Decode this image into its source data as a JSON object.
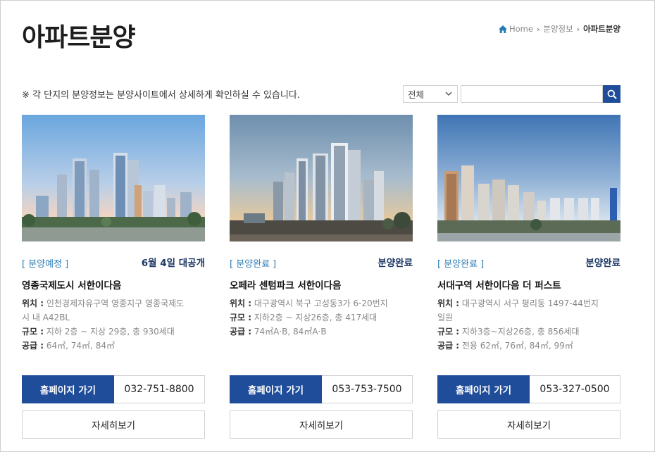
{
  "page": {
    "title": "아파트분양",
    "breadcrumb": [
      "Home",
      "분양정보",
      "아파트분양"
    ]
  },
  "notice": "※ 각 단지의 분양정보는 분양사이트에서 상세하게 확인하실 수 있습니다.",
  "filter": {
    "selected": "전체",
    "search_value": ""
  },
  "colors": {
    "primary": "#1f4d99",
    "status_tag": "#2a7bb5",
    "status_right": "#1e3a66"
  },
  "icons": {
    "home": "home-icon",
    "search": "search-icon",
    "select": "chevron-down-icon"
  },
  "cards": [
    {
      "tag": "[ 분양예정 ]",
      "status": "6월 4일 대공개",
      "name": "영종국제도시 서한이다음",
      "location_label": "위치 :",
      "location": "인천경제자유구역 영종지구 영종국제도",
      "location_cont": "시 내 A42BL",
      "scale_label": "규모 :",
      "scale": "지하 2층 ~ 지상 29층, 총 930세대",
      "supply_label": "공급 :",
      "supply": "64㎡, 74㎡, 84㎡",
      "homepage_label": "홈페이지 가기",
      "phone": "032-751-8800",
      "detail_label": "자세히보기"
    },
    {
      "tag": "[ 분양완료 ]",
      "status": "분양완료",
      "name": "오페라 센텀파크 서한이다음",
      "location_label": "위치 :",
      "location": "대구광역시 북구 고성동3가 6-20번지",
      "location_cont": "",
      "scale_label": "규모 :",
      "scale": "지하2층 ~ 지상26층, 총 417세대",
      "supply_label": "공급 :",
      "supply": "74㎡A·B, 84㎡A·B",
      "homepage_label": "홈페이지 가기",
      "phone": "053-753-7500",
      "detail_label": "자세히보기"
    },
    {
      "tag": "[ 분양완료 ]",
      "status": "분양완료",
      "name": "서대구역 서한이다음 더 퍼스트",
      "location_label": "위치 :",
      "location": "대구광역시 서구 평리동 1497-44번지",
      "location_cont": "일원",
      "scale_label": "규모 :",
      "scale": "지하3층~지상26층, 총 856세대",
      "supply_label": "공급 :",
      "supply": "전용 62㎡, 76㎡, 84㎡, 99㎡",
      "homepage_label": "홈페이지 가기",
      "phone": "053-327-0500",
      "detail_label": "자세히보기"
    }
  ]
}
